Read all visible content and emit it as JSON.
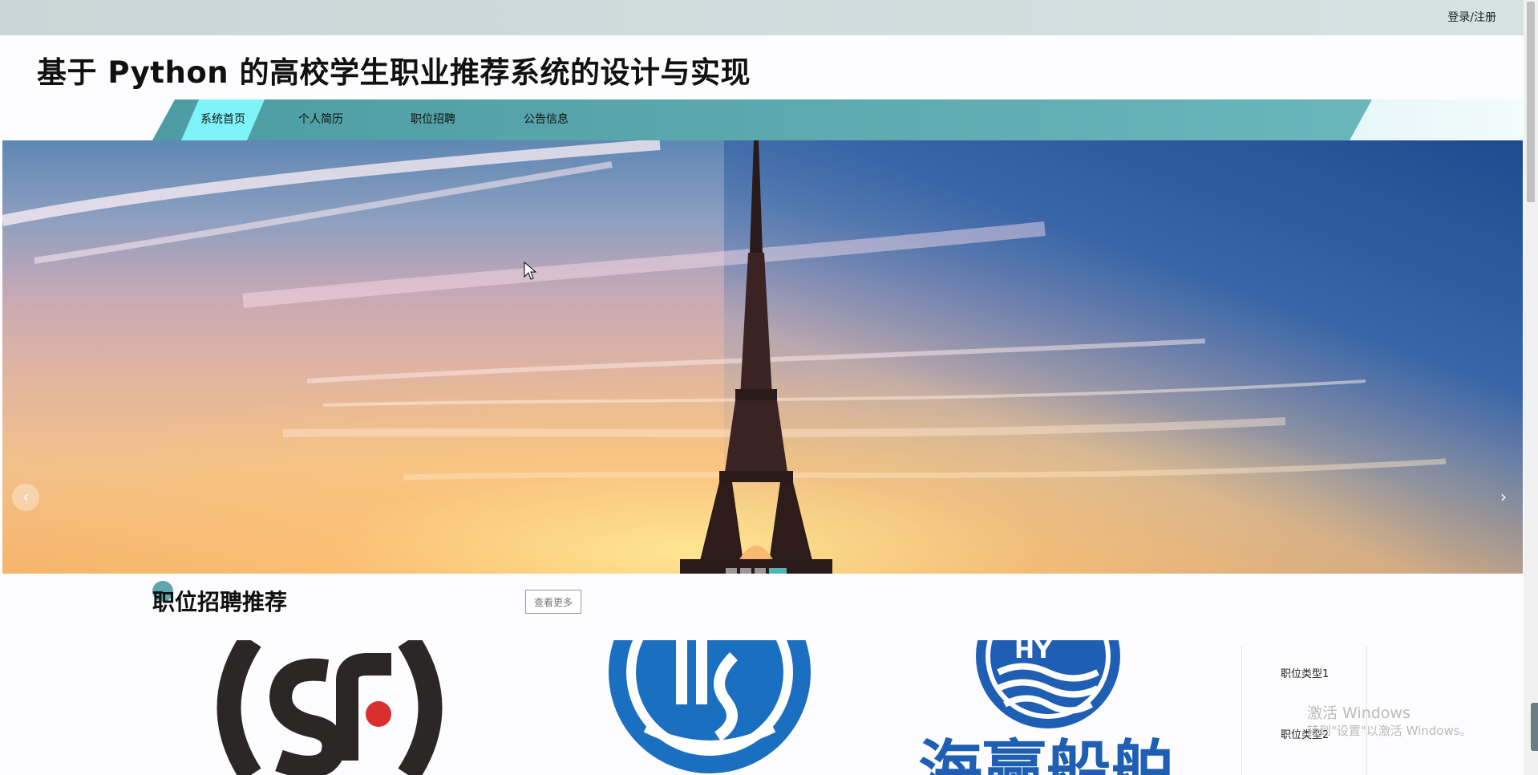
{
  "header": {
    "login_register": "登录/注册",
    "site_title": "基于 Python 的高校学生职业推荐系统的设计与实现"
  },
  "nav": {
    "items": [
      {
        "label": "系统首页",
        "active": true
      },
      {
        "label": "个人简历",
        "active": false
      },
      {
        "label": "职位招聘",
        "active": false
      },
      {
        "label": "公告信息",
        "active": false
      }
    ],
    "accent_color": "#5ba9ae",
    "active_color": "#7ff4f8"
  },
  "carousel": {
    "prev_icon": "chevron-left-icon",
    "prev_label": "‹",
    "next_icon": "chevron-right-icon",
    "next_label": "›",
    "slide_count": 4,
    "active_slide": 4
  },
  "recommend": {
    "title": "职位招聘推荐",
    "more_label": "查看更多",
    "logos": [
      {
        "name": "sf-logo"
      },
      {
        "name": "ship-circle-logo"
      },
      {
        "name": "haiying-logo",
        "text": "海赢船舶",
        "badge": "HY"
      }
    ]
  },
  "side_panel": {
    "items": [
      "职位类型1",
      "职位类型2"
    ]
  },
  "watermark": {
    "title": "激活 Windows",
    "subtitle": "转到\"设置\"以激活 Windows。"
  }
}
